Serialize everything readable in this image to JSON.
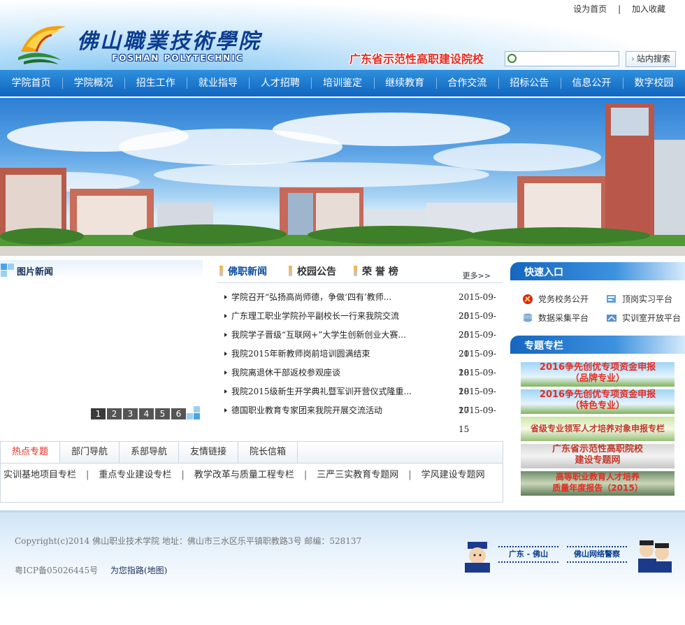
{
  "header": {
    "top_links": [
      "设为首页",
      "|",
      "加入收藏"
    ],
    "logo_cn": "佛山職業技術學院",
    "logo_en": "FOSHAN POLYTECHNIC",
    "slogan": "广东省示范性高职建设院校",
    "search_placeholder": "",
    "search_button": "站内搜索"
  },
  "nav": [
    "学院首页",
    "学院概况",
    "招生工作",
    "就业指导",
    "人才招聘",
    "培训鉴定",
    "继续教育",
    "合作交流",
    "招标公告",
    "信息公开",
    "数字校园"
  ],
  "pic_news": {
    "title": "图片新闻",
    "pages": [
      "1",
      "2",
      "3",
      "4",
      "5",
      "6"
    ]
  },
  "news": {
    "tabs": [
      "佛职新闻",
      "校园公告",
      "荣 誉 榜"
    ],
    "more": "更多>>",
    "items": [
      {
        "title": "学院召开“弘扬高尚师德，争做‘四有’教师...",
        "date": "2015-09-25"
      },
      {
        "title": "广东理工职业学院孙平副校长一行来我院交流",
        "date": "2015-09-25"
      },
      {
        "title": "我院学子晋级“互联网+”大学生创新创业大赛...",
        "date": "2015-09-21"
      },
      {
        "title": "我院2015年新教师岗前培训圆满结束",
        "date": "2015-09-18"
      },
      {
        "title": "我院离退休干部返校参观座谈",
        "date": "2015-09-18"
      },
      {
        "title": "我院2015级新生开学典礼暨军训开营仪式隆重...",
        "date": "2015-09-17"
      },
      {
        "title": "德国职业教育专家团来我院开展交流活动",
        "date": "2015-09-15"
      }
    ]
  },
  "quick": {
    "title": "快速入口",
    "items": [
      "党务校务公开",
      "顶岗实习平台",
      "数据采集平台",
      "实训室开放平台"
    ]
  },
  "topics": {
    "title": "专题专栏",
    "items": [
      {
        "line1": "2016争先创优专项资金申报",
        "line2": "（品牌专业）"
      },
      {
        "line1": "2016争先创优专项资金申报",
        "line2": "（特色专业）"
      },
      {
        "line1": "省级专业领军人才培养对象申报专栏",
        "line2": ""
      },
      {
        "line1": "广东省示范性高职院校",
        "line2": "建设专题网"
      },
      {
        "line1": "高等职业教育人才培养",
        "line2": "质量年度报告（2015）"
      }
    ]
  },
  "lower": {
    "tabs": [
      "热点专题",
      "部门导航",
      "系部导航",
      "友情链接",
      "院长信箱"
    ],
    "links": [
      "实训基地项目专栏",
      "重点专业建设专栏",
      "教学改革与质量工程专栏",
      "三严三实教育专题网",
      "学风建设专题网"
    ]
  },
  "footer": {
    "copyright": "Copyright(c)2014 佛山职业技术学院  地址：佛山市三水区乐平镇职教路3号  邮编：528137",
    "icp": "粤ICP备05026445号",
    "map_link": "为您指路(地图)",
    "police_labels": [
      "广东 - 佛山",
      "佛山网络警察"
    ]
  },
  "colors": {
    "nav_bg": "#1a74cc",
    "brand_blue": "#0b3c8f",
    "slogan_red": "#e52b22",
    "active_tab_red": "#e52b22"
  }
}
